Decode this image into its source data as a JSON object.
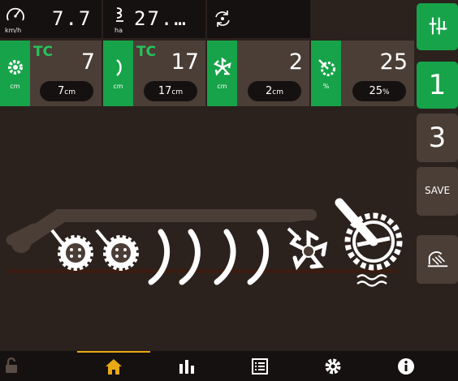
{
  "topbar": {
    "speed": {
      "icon": "speedometer-icon",
      "value": "7.7",
      "unit": "km/h"
    },
    "area": {
      "icon": "area-counter-icon",
      "value": "27.…",
      "unit": "ha"
    },
    "cycle": {
      "icon": "cycle-arrows-icon"
    }
  },
  "params": [
    {
      "icon": "wheel-gear-icon",
      "unit": "cm",
      "tc": "TC",
      "value": "7",
      "pill_value": "7",
      "pill_unit": "cm"
    },
    {
      "icon": "disc-icon",
      "unit": "cm",
      "tc": "TC",
      "value": "17",
      "pill_value": "17",
      "pill_unit": "cm"
    },
    {
      "icon": "rotor-icon",
      "unit": "cm",
      "tc": "",
      "value": "2",
      "pill_value": "2",
      "pill_unit": "cm"
    },
    {
      "icon": "roller-gauge-icon",
      "unit": "%",
      "tc": "",
      "value": "25",
      "pill_value": "25",
      "pill_unit": "%"
    }
  ],
  "side": {
    "tool_select_icon": "tool-select-icon",
    "preset_1": "1",
    "preset_3": "3",
    "save": "SAVE",
    "headland_icon": "headland-icon"
  },
  "bottom": {
    "lock_icon": "unlock-icon",
    "home_icon": "home-icon",
    "stats_icon": "bar-chart-icon",
    "list_icon": "list-icon",
    "settings_icon": "gear-icon",
    "info_icon": "info-icon"
  },
  "colors": {
    "green": "#17a349",
    "tc_green": "#26c45d",
    "accent": "#e7a914",
    "panel": "#4b3e37",
    "background": "#2b211d",
    "soil": "#3a1c10"
  }
}
